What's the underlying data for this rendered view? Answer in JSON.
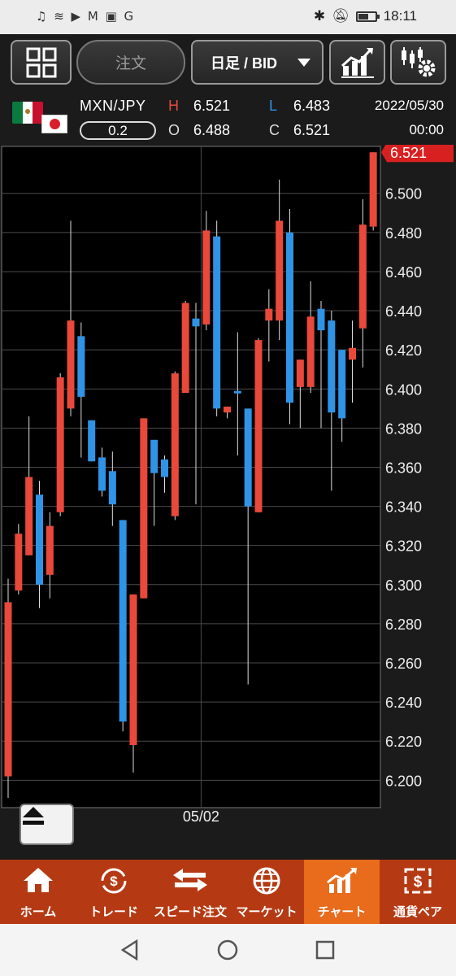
{
  "status_bar": {
    "left_icons": "♫ ≋ ▶ M ▣ G",
    "time": "18:11"
  },
  "toolbar": {
    "order_label": "注文",
    "period_label": "日足 / BID"
  },
  "quote": {
    "pair": "MXN/JPY",
    "spread": "0.2",
    "high_label": "H",
    "high": "6.521",
    "low_label": "L",
    "low": "6.483",
    "open_label": "O",
    "open": "6.488",
    "close_label": "C",
    "close": "6.521",
    "date": "2022/05/30",
    "time": "00:00"
  },
  "colors": {
    "up": "#e8493a",
    "down": "#2f93e6",
    "current_price_tag": "#d82020",
    "nav_bg": "#b53a13",
    "nav_active": "#e96b1c"
  },
  "chart_data": {
    "type": "candlestick",
    "x_tick_label": "05/02",
    "x_tick_index": 18.5,
    "current_price": "6.521",
    "ylim": [
      6.186,
      6.524
    ],
    "y_ticks": [
      "6.500",
      "6.480",
      "6.460",
      "6.440",
      "6.420",
      "6.400",
      "6.380",
      "6.360",
      "6.340",
      "6.320",
      "6.300",
      "6.280",
      "6.260",
      "6.240",
      "6.220",
      "6.200"
    ],
    "candles": [
      {
        "o": 6.202,
        "h": 6.303,
        "l": 6.191,
        "c": 6.291
      },
      {
        "o": 6.297,
        "h": 6.331,
        "l": 6.295,
        "c": 6.326
      },
      {
        "o": 6.315,
        "h": 6.386,
        "l": 6.315,
        "c": 6.355
      },
      {
        "o": 6.346,
        "h": 6.353,
        "l": 6.288,
        "c": 6.3
      },
      {
        "o": 6.305,
        "h": 6.337,
        "l": 6.293,
        "c": 6.33
      },
      {
        "o": 6.337,
        "h": 6.408,
        "l": 6.335,
        "c": 6.406
      },
      {
        "o": 6.39,
        "h": 6.486,
        "l": 6.386,
        "c": 6.435
      },
      {
        "o": 6.427,
        "h": 6.434,
        "l": 6.365,
        "c": 6.396
      },
      {
        "o": 6.384,
        "h": 6.384,
        "l": 6.363,
        "c": 6.363
      },
      {
        "o": 6.365,
        "h": 6.37,
        "l": 6.345,
        "c": 6.348
      },
      {
        "o": 6.358,
        "h": 6.368,
        "l": 6.33,
        "c": 6.341
      },
      {
        "o": 6.333,
        "h": 6.333,
        "l": 6.225,
        "c": 6.23
      },
      {
        "o": 6.218,
        "h": 6.295,
        "l": 6.204,
        "c": 6.295
      },
      {
        "o": 6.293,
        "h": 6.385,
        "l": 6.293,
        "c": 6.385
      },
      {
        "o": 6.374,
        "h": 6.374,
        "l": 6.33,
        "c": 6.357
      },
      {
        "o": 6.364,
        "h": 6.366,
        "l": 6.347,
        "c": 6.355
      },
      {
        "o": 6.335,
        "h": 6.409,
        "l": 6.333,
        "c": 6.408
      },
      {
        "o": 6.398,
        "h": 6.445,
        "l": 6.398,
        "c": 6.444
      },
      {
        "o": 6.436,
        "h": 6.444,
        "l": 6.341,
        "c": 6.432
      },
      {
        "o": 6.433,
        "h": 6.491,
        "l": 6.43,
        "c": 6.481
      },
      {
        "o": 6.478,
        "h": 6.486,
        "l": 6.386,
        "c": 6.39
      },
      {
        "o": 6.388,
        "h": 6.389,
        "l": 6.385,
        "c": 6.391
      },
      {
        "o": 6.399,
        "h": 6.429,
        "l": 6.366,
        "c": 6.398
      },
      {
        "o": 6.39,
        "h": 6.389,
        "l": 6.249,
        "c": 6.34
      },
      {
        "o": 6.337,
        "h": 6.426,
        "l": 6.337,
        "c": 6.425
      },
      {
        "o": 6.435,
        "h": 6.451,
        "l": 6.414,
        "c": 6.441
      },
      {
        "o": 6.435,
        "h": 6.507,
        "l": 6.425,
        "c": 6.486
      },
      {
        "o": 6.48,
        "h": 6.492,
        "l": 6.382,
        "c": 6.393
      },
      {
        "o": 6.401,
        "h": 6.412,
        "l": 6.38,
        "c": 6.415
      },
      {
        "o": 6.401,
        "h": 6.455,
        "l": 6.398,
        "c": 6.437
      },
      {
        "o": 6.441,
        "h": 6.445,
        "l": 6.38,
        "c": 6.43
      },
      {
        "o": 6.435,
        "h": 6.44,
        "l": 6.348,
        "c": 6.388
      },
      {
        "o": 6.42,
        "h": 6.42,
        "l": 6.373,
        "c": 6.385
      },
      {
        "o": 6.415,
        "h": 6.435,
        "l": 6.393,
        "c": 6.421
      },
      {
        "o": 6.431,
        "h": 6.497,
        "l": 6.411,
        "c": 6.484
      },
      {
        "o": 6.483,
        "h": 6.521,
        "l": 6.481,
        "c": 6.521
      }
    ]
  },
  "bottom_nav": [
    {
      "label": "ホーム",
      "icon": "home-icon"
    },
    {
      "label": "トレード",
      "icon": "trade-icon"
    },
    {
      "label": "スピード注文",
      "icon": "speed-order-icon"
    },
    {
      "label": "マーケット",
      "icon": "globe-icon"
    },
    {
      "label": "チャート",
      "icon": "chart-icon",
      "active": true
    },
    {
      "label": "通貨ペア",
      "icon": "currency-pair-icon"
    }
  ]
}
